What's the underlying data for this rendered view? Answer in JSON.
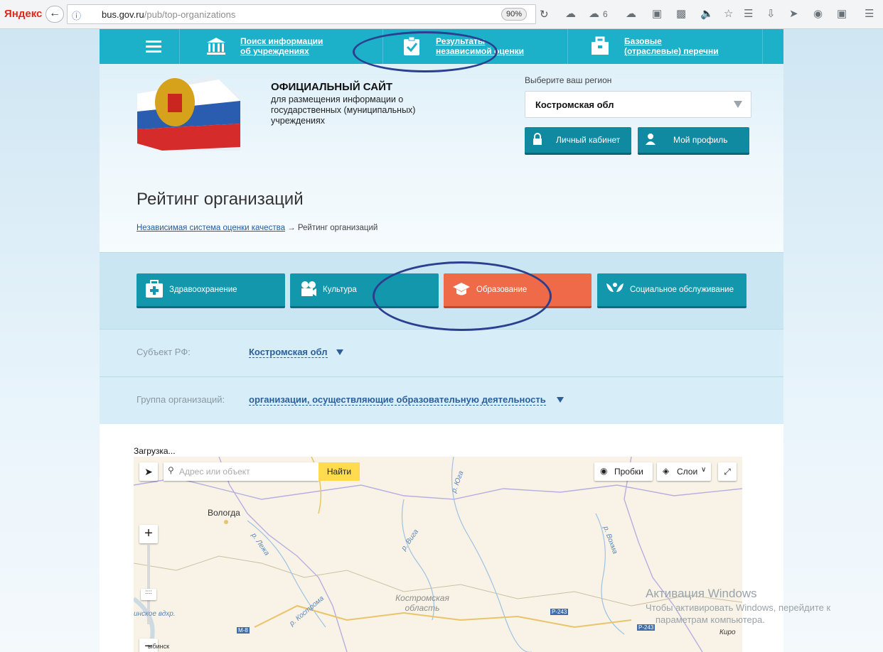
{
  "browser": {
    "brand": "Яндекс",
    "url_host": "bus.gov.ru",
    "url_path": "/pub/top-organizations",
    "zoom": "90%",
    "weather_count": "6"
  },
  "nav": {
    "items": [
      {
        "label1": "Поиск информации",
        "label2": "об учреждениях"
      },
      {
        "label1": "Результаты",
        "label2": "независимой оценки"
      },
      {
        "label1": "Базовые",
        "label2": "(отраслевые) перечни"
      }
    ]
  },
  "header": {
    "site_title": "ОФИЦИАЛЬНЫЙ САЙТ",
    "site_sub": "для размещения информации о государственных (муниципальных) учреждениях",
    "region_label": "Выберите ваш регион",
    "region_value": "Костромская обл",
    "cabinet_label": "Личный кабинет",
    "profile_label": "Мой профиль"
  },
  "page": {
    "title": "Рейтинг организаций",
    "breadcrumb_link": "Независимая система оценки качества",
    "breadcrumb_sep": "→",
    "breadcrumb_current": "Рейтинг организаций"
  },
  "categories": [
    {
      "label": "Здравоохранение",
      "active": false
    },
    {
      "label": "Культура",
      "active": false
    },
    {
      "label": "Образование",
      "active": true
    },
    {
      "label": "Социальное обслуживание",
      "active": false
    }
  ],
  "filters": {
    "subject_label": "Субъект РФ:",
    "subject_value": "Костромская обл",
    "group_label": "Группа организаций:",
    "group_value": "организации, осуществляющие образовательную деятельность"
  },
  "map": {
    "loading": "Загрузка...",
    "search_placeholder": "Адрес или объект",
    "find_label": "Найти",
    "traffic_label": "Пробки",
    "layers_label": "Слои",
    "cities": {
      "vologda": "Вологда",
      "rybinsk": "ыбинск",
      "kiro": "Киро"
    },
    "rivers": {
      "yuga": "р. Юга",
      "lezha": "р. Лежа",
      "viga": "р. Вига",
      "vokhma": "р. Вохма",
      "kostroma": "р. Кострома",
      "reservoir": "инское вдхр."
    },
    "region": "Костромская область",
    "roads": {
      "m8": "М-8",
      "r243a": "Р-243",
      "r243b": "Р-243"
    }
  },
  "watermark": {
    "line1": "Активация Windows",
    "line2": "Чтобы активировать Windows, перейдите к",
    "line3": "параметрам компьютера."
  },
  "colors": {
    "nav_teal": "#1db1c9",
    "category_teal": "#1397ad",
    "category_active": "#ee6a48",
    "annotation_ellipse": "#2b3f8f"
  }
}
